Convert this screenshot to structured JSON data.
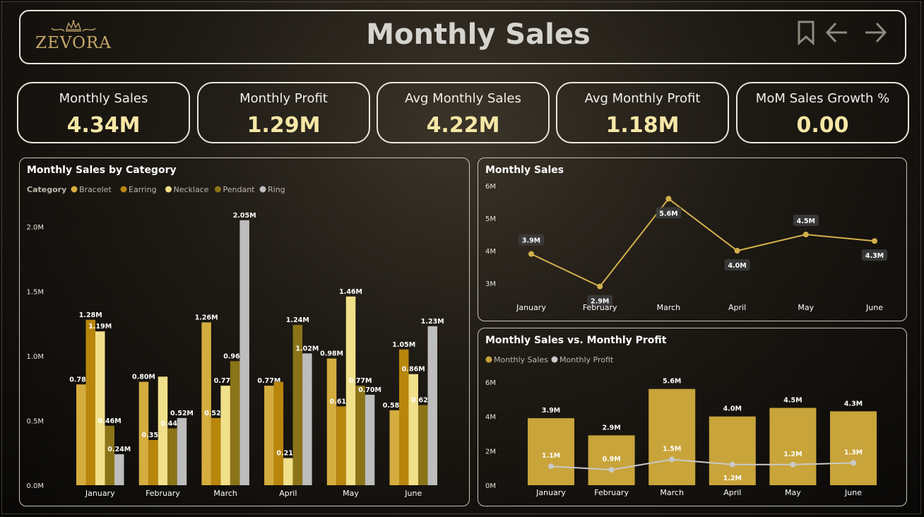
{
  "header": {
    "logo_text": "ZEVORA",
    "title": "Monthly Sales",
    "icons": [
      "bookmark-icon",
      "arrow-left-icon",
      "arrow-right-icon"
    ]
  },
  "kpis": [
    {
      "label": "Monthly Sales",
      "value": "4.34M"
    },
    {
      "label": "Monthly Profit",
      "value": "1.29M"
    },
    {
      "label": "Avg Monthly Sales",
      "value": "4.22M"
    },
    {
      "label": "Avg Monthly Profit",
      "value": "1.18M"
    },
    {
      "label": "MoM Sales Growth %",
      "value": "0.00"
    }
  ],
  "colors": {
    "bracelet": "#d4ad3e",
    "earring": "#b8860b",
    "necklace": "#f1e08a",
    "pendant": "#8b7417",
    "ring": "#bdbdbd",
    "line": "#d4b04c",
    "profit_line": "#c9c9c9",
    "bar_sales": "#c8a43a",
    "kpi_value": "#f6e7a6"
  },
  "chart_data": [
    {
      "type": "bar",
      "title": "Monthly Sales by Category",
      "legend_title": "Category",
      "legend_position": "top-left",
      "categories": [
        "January",
        "February",
        "March",
        "April",
        "May",
        "June"
      ],
      "series": [
        {
          "name": "Bracelet",
          "values": [
            0.78,
            0.8,
            1.26,
            0.77,
            0.98,
            0.58
          ],
          "labels": [
            "0.78M",
            "0.80M",
            "1.26M",
            "0.77M",
            "0.98M",
            "0.58M"
          ]
        },
        {
          "name": "Earring",
          "values": [
            1.28,
            0.35,
            0.52,
            0.8,
            0.61,
            1.05
          ],
          "labels": [
            "1.28M",
            "0.35M",
            "0.52M",
            "",
            "0.61M",
            "1.05M"
          ]
        },
        {
          "name": "Necklace",
          "values": [
            1.19,
            0.84,
            0.77,
            0.21,
            1.46,
            0.86
          ],
          "labels": [
            "1.19M",
            "",
            "0.77M",
            "0.21M",
            "1.46M",
            "0.86M"
          ]
        },
        {
          "name": "Pendant",
          "values": [
            0.46,
            0.44,
            0.96,
            1.24,
            0.77,
            0.62
          ],
          "labels": [
            "0.46M",
            "0.44M",
            "0.96M",
            "1.24M",
            "0.77M",
            "0.62M"
          ]
        },
        {
          "name": "Ring",
          "values": [
            0.24,
            0.52,
            2.05,
            1.02,
            0.7,
            1.23
          ],
          "labels": [
            "0.24M",
            "0.52M",
            "2.05M",
            "1.02M",
            "0.70M",
            "1.23M"
          ]
        }
      ],
      "yticks": [
        "0.0M",
        "0.5M",
        "1.0M",
        "1.5M",
        "2.0M"
      ],
      "ylim": [
        0,
        2.0
      ]
    },
    {
      "type": "line",
      "title": "Monthly Sales",
      "categories": [
        "January",
        "February",
        "March",
        "April",
        "May",
        "June"
      ],
      "values": [
        3.9,
        2.9,
        5.6,
        4.0,
        4.5,
        4.3
      ],
      "labels": [
        "3.9M",
        "2.9M",
        "5.6M",
        "4.0M",
        "4.5M",
        "4.3M"
      ],
      "yticks": [
        "3M",
        "4M",
        "5M",
        "6M"
      ],
      "ylim": [
        3,
        6
      ]
    },
    {
      "type": "bar",
      "title": "Monthly Sales vs. Monthly Profit",
      "legend_position": "top-left",
      "categories": [
        "January",
        "February",
        "March",
        "April",
        "May",
        "June"
      ],
      "series": [
        {
          "name": "Monthly Sales",
          "kind": "bar",
          "values": [
            3.9,
            2.9,
            5.6,
            4.0,
            4.5,
            4.3
          ],
          "labels": [
            "3.9M",
            "2.9M",
            "5.6M",
            "4.0M",
            "4.5M",
            "4.3M"
          ]
        },
        {
          "name": "Monthly Profit",
          "kind": "line",
          "values": [
            1.1,
            0.9,
            1.5,
            1.2,
            1.2,
            1.3
          ],
          "labels": [
            "1.1M",
            "0.9M",
            "1.5M",
            "1.2M",
            "1.2M",
            "1.3M"
          ]
        }
      ],
      "yticks": [
        "0M",
        "2M",
        "4M",
        "6M"
      ],
      "ylim": [
        0,
        6
      ]
    }
  ]
}
